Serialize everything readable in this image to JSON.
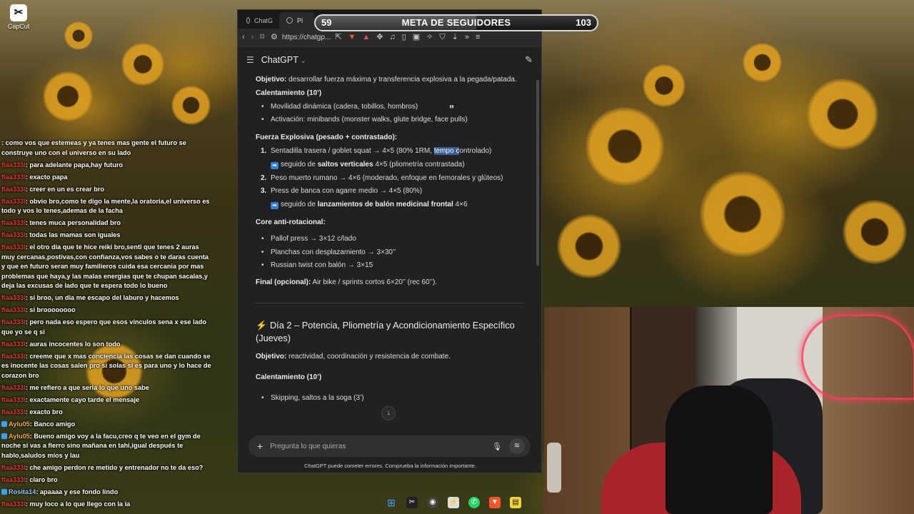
{
  "desktop": {
    "icon_label": "CapCut"
  },
  "goal": {
    "current": "59",
    "label": "META DE SEGUIDORES",
    "target": "103",
    "progress_fraction": 0.57
  },
  "browser": {
    "tabs": [
      {
        "label": "ChatG"
      },
      {
        "label": "Pl"
      }
    ],
    "url": "https://chatgp..."
  },
  "chatgpt": {
    "title": "ChatGPT",
    "objective1_label": "Objetivo:",
    "objective1_text": " desarrollar fuerza máxima y transferencia explosiva a la pegada/patada.",
    "warmup1_title": "Calentamiento (10’)",
    "warmup1_items": [
      "Movilidad dinámica (cadera, tobillos, hombros)",
      "Activación: minibands (monster walks, glute bridge, face pulls)"
    ],
    "explosive_title": "Fuerza Explosiva (pesado + contrastado):",
    "ex1_n": "1.",
    "ex1_a": "Sentadilla trasera / goblet squat → 4×5 (80% 1RM, ",
    "ex1_hl": "tempo c",
    "ex1_b": "ontrolado)",
    "ex1_sub_a": "seguido de ",
    "ex1_sub_bold": "saltos verticales",
    "ex1_sub_b": " 4×5 (pliometría contrastada)",
    "ex2_n": "2.",
    "ex2": "Peso muerto rumano → 4×6 (moderado, enfoque en femorales y glúteos)",
    "ex3_n": "3.",
    "ex3": "Press de banca con agarre medio → 4×5 (80%)",
    "ex3_sub_a": "seguido de ",
    "ex3_sub_bold": "lanzamientos de balón medicinal frontal",
    "ex3_sub_b": " 4×6",
    "core_title": "Core anti-rotacional:",
    "core_items": [
      "Pallof press → 3×12 c/lado",
      "Planchas con desplazamiento → 3×30’’",
      "Russian twist con balón → 3×15"
    ],
    "final_label": "Final (opcional):",
    "final_text": " Air bike / sprints cortos 6×20’’ (rec 60’’).",
    "day2_title": "Día 2 – Potencia, Pliometría y Acondicionamiento Específico (Jueves)",
    "objective2_label": "Objetivo:",
    "objective2_text": " reactividad, coordinación y resistencia de combate.",
    "warmup2_title": "Calentamiento (10’)",
    "warmup2_items": [
      "Skipping, saltos a la soga (3’)"
    ],
    "composer_placeholder": "Pregunta lo que quieras",
    "disclaimer": "ChatGPT puede cometer errores. Comprueba la información importante."
  },
  "chat_messages": [
    {
      "user": "",
      "text": ": como vos que estemeas y ya tenes mas gente el futuro se construye uno con el universo en su lado"
    },
    {
      "user": "flaa333l",
      "text": ": para adelante papa,hay futuro"
    },
    {
      "user": "flaa333l",
      "text": ": exacto papa"
    },
    {
      "user": "flaa333l",
      "text": ": creer en un es crear bro"
    },
    {
      "user": "flaa333l",
      "text": ": obvio bro,como te digo la mente,la oratoria,el universo es todo y vos lo tenes,ademas de la facha"
    },
    {
      "user": "flaa333l",
      "text": ": tenes muca personalidad bro"
    },
    {
      "user": "flaa333l",
      "text": ": todas las mamas son iguales"
    },
    {
      "user": "flaa333l",
      "text": ": el otro dia que te hice reiki bro,senti que tenes 2 auras muy cercanas,postivas,con confianza,vos sabes o te daras cuenta y que en futuro seran muy familieros cuida esa cercania por mas problemas que haya,y las malas energias que te chupan sacalas,y deja las excusas de lado que te espera todo lo bueno"
    },
    {
      "user": "flaa333l",
      "text": ": si broo, un dia me escapo del laburo y hacemos"
    },
    {
      "user": "flaa333l",
      "text": ": si broooooooo"
    },
    {
      "user": "flaa333l",
      "text": ": pero nada eso espero que esos vinculos sena x ese lado que yo se q si"
    },
    {
      "user": "flaa333l",
      "text": ": auras incocentes lo son todo"
    },
    {
      "user": "flaa333l",
      "text": ": creeme que x mas conciencia las cosas se dan cuando se es inocente las cosas salen pro si solas si es para uno y lo hace de corazon bro"
    },
    {
      "user": "flaa333l",
      "text": ": me refiero a que seria lo que uno sabe"
    },
    {
      "user": "flaa333l",
      "text": ": exactamente cayo tarde el mensaje"
    },
    {
      "user": "flaa333l",
      "text": ": exacto bro"
    },
    {
      "user": "Aylu05",
      "text": ": Banco amigo",
      "alt": true
    },
    {
      "user": "Aylu05",
      "text": ": Bueno amigo voy a la facu,creo q te veo en el gym de noche si vas a fierro sino mañana en tahi,igual después te hablo,saludos míos y lau",
      "alt": true
    },
    {
      "user": "flaa333l",
      "text": ": che amigo perdon re metido y entrenador no te da eso?"
    },
    {
      "user": "flaa333l",
      "text": ": claro bro"
    },
    {
      "user": "Rosita14",
      "text": ": apaaaa y ese fondo lindo",
      "alt2": true
    },
    {
      "user": "flaa333l",
      "text": ": muy loco a lo que llego con la ia"
    }
  ]
}
